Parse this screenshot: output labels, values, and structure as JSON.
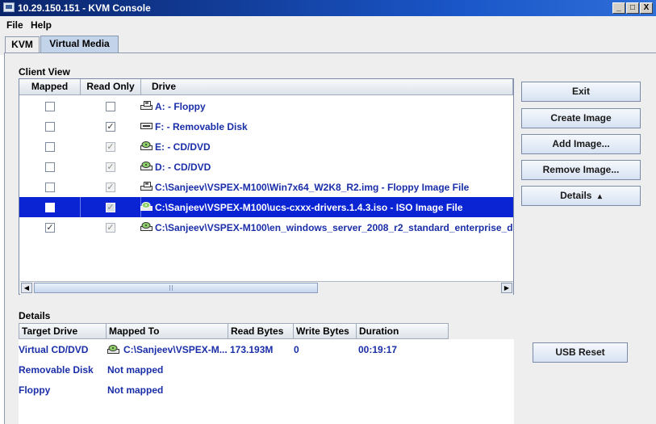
{
  "window": {
    "title": "10.29.150.151 - KVM Console",
    "controls": [
      "_",
      "□",
      "X"
    ]
  },
  "menu": [
    "File",
    "Help"
  ],
  "tabs": [
    {
      "label": "KVM",
      "active": false
    },
    {
      "label": "Virtual Media",
      "active": true
    }
  ],
  "client_view": {
    "label": "Client View",
    "columns": [
      "Mapped",
      "Read Only",
      "Drive"
    ],
    "rows": [
      {
        "mapped": false,
        "read_only": false,
        "read_only_enabled": true,
        "icon": "floppy-drive-icon",
        "drive": "A: - Floppy",
        "selected": false
      },
      {
        "mapped": false,
        "read_only": true,
        "read_only_enabled": true,
        "icon": "removable-disk-icon",
        "drive": "F: - Removable Disk",
        "selected": false
      },
      {
        "mapped": false,
        "read_only": true,
        "read_only_enabled": false,
        "icon": "cd-drive-icon",
        "drive": "E: - CD/DVD",
        "selected": false
      },
      {
        "mapped": false,
        "read_only": true,
        "read_only_enabled": false,
        "icon": "cd-drive-icon",
        "drive": "D: - CD/DVD",
        "selected": false
      },
      {
        "mapped": false,
        "read_only": true,
        "read_only_enabled": false,
        "icon": "floppy-drive-icon",
        "drive": "C:\\Sanjeev\\VSPEX-M100\\Win7x64_W2K8_R2.img - Floppy Image File",
        "selected": false
      },
      {
        "mapped": false,
        "read_only": true,
        "read_only_enabled": false,
        "icon": "cd-drive-icon",
        "drive": "C:\\Sanjeev\\VSPEX-M100\\ucs-cxxx-drivers.1.4.3.iso - ISO Image File",
        "selected": true
      },
      {
        "mapped": true,
        "read_only": true,
        "read_only_enabled": false,
        "icon": "cd-drive-icon",
        "drive": "C:\\Sanjeev\\VSPEX-M100\\en_windows_server_2008_r2_standard_enterprise_d",
        "selected": false
      }
    ]
  },
  "buttons": {
    "exit": "Exit",
    "create_image": "Create Image",
    "add_image": "Add Image...",
    "remove_image": "Remove Image...",
    "details": "Details",
    "details_arrow": "▴",
    "usb_reset": "USB Reset"
  },
  "details": {
    "label": "Details",
    "columns": [
      "Target Drive",
      "Mapped To",
      "Read Bytes",
      "Write Bytes",
      "Duration"
    ],
    "rows": [
      {
        "target": "Virtual CD/DVD",
        "mapped_to": "C:\\Sanjeev\\VSPEX-M...",
        "mapped_icon": "cd-drive-icon",
        "read_bytes": "173.193M",
        "write_bytes": "0",
        "duration": "00:19:17"
      },
      {
        "target": "Removable Disk",
        "mapped_to": "Not mapped",
        "mapped_icon": "",
        "read_bytes": "",
        "write_bytes": "",
        "duration": ""
      },
      {
        "target": "Floppy",
        "mapped_to": "Not mapped",
        "mapped_icon": "",
        "read_bytes": "",
        "write_bytes": "",
        "duration": ""
      }
    ]
  },
  "colors": {
    "selection": "#0a24d4",
    "link_text": "#1a2ea8",
    "title_bar": "#0a246a"
  }
}
